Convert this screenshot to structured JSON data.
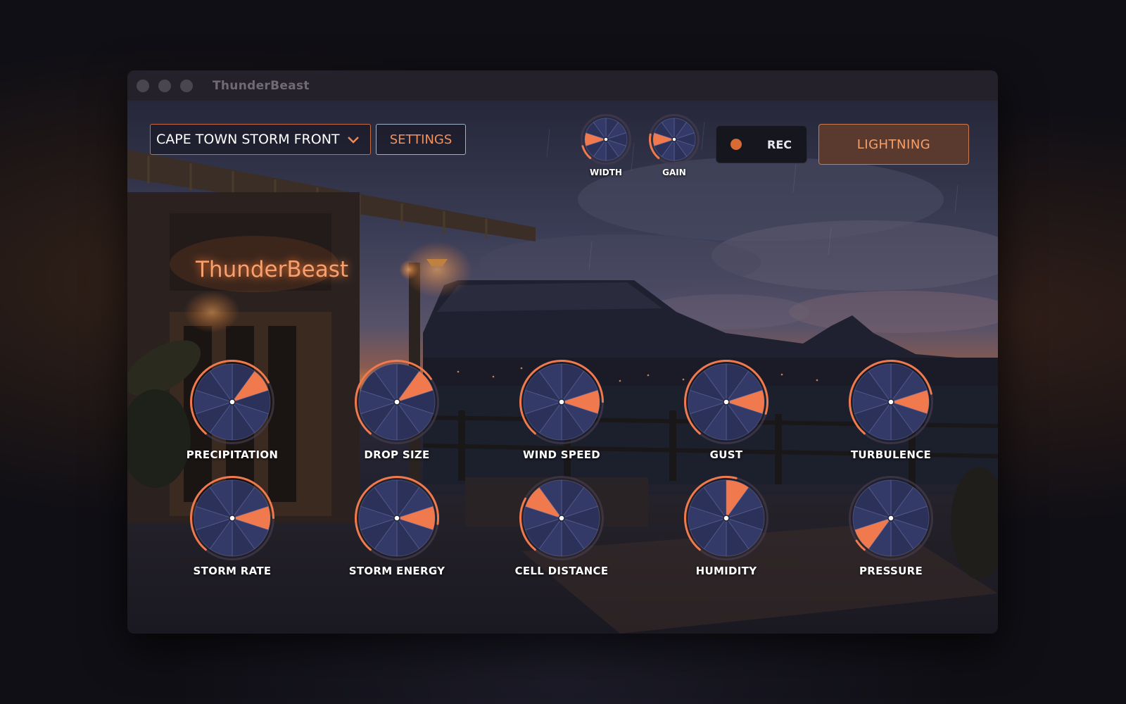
{
  "window": {
    "title": "ThunderBeast"
  },
  "scene": {
    "sign_text": "ThunderBeast"
  },
  "toolbar": {
    "preset_value": "CAPE TOWN STORM FRONT",
    "settings_label": "SETTINGS",
    "rec_label": "REC",
    "lightning_label": "LIGHTNING"
  },
  "small_knobs": [
    {
      "label": "WIDTH",
      "value": 0.12
    },
    {
      "label": "GAIN",
      "value": 0.22
    }
  ],
  "knobs": [
    {
      "label": "PRECIPITATION",
      "value": 0.72
    },
    {
      "label": "DROP SIZE",
      "value": 0.7
    },
    {
      "label": "WIND SPEED",
      "value": 0.82
    },
    {
      "label": "GUST",
      "value": 0.88
    },
    {
      "label": "TURBULENCE",
      "value": 0.78
    },
    {
      "label": "STORM RATE",
      "value": 0.82
    },
    {
      "label": "STORM ENERGY",
      "value": 0.85
    },
    {
      "label": "CELL DISTANCE",
      "value": 0.28
    },
    {
      "label": "HUMIDITY",
      "value": 0.55
    },
    {
      "label": "PRESSURE",
      "value": 0.06
    }
  ],
  "colors": {
    "accent": "#f07a4e",
    "knob_face": "#343a68",
    "knob_face_alt": "#2c315a"
  }
}
